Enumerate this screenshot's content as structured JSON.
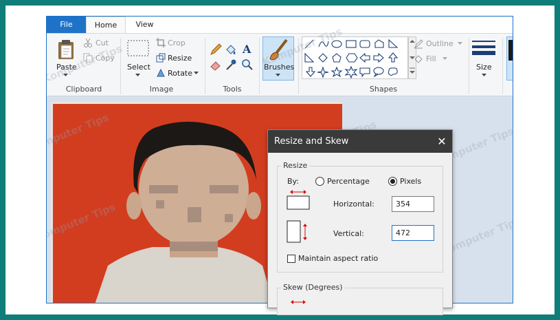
{
  "tabs": {
    "file": "File",
    "home": "Home",
    "view": "View"
  },
  "clipboard": {
    "paste": "Paste",
    "cut": "Cut",
    "copy": "Copy",
    "label": "Clipboard"
  },
  "image": {
    "select": "Select",
    "crop": "Crop",
    "resize": "Resize",
    "rotate": "Rotate",
    "label": "Image"
  },
  "tools": {
    "label": "Tools"
  },
  "brushes": {
    "label": "Brushes"
  },
  "shapes": {
    "outline": "Outline",
    "fill": "Fill",
    "label": "Shapes"
  },
  "size": {
    "label": "Size"
  },
  "dialog": {
    "title": "Resize and Skew",
    "close": "✕",
    "resize_legend": "Resize",
    "by_label": "By:",
    "percentage": "Percentage",
    "pixels": "Pixels",
    "horizontal_label": "Horizontal:",
    "horizontal_value": "354",
    "vertical_label": "Vertical:",
    "vertical_value": "472",
    "maintain_aspect": "Maintain aspect ratio",
    "skew_legend": "Skew (Degrees)"
  },
  "watermark": "Komputer Tips",
  "colors": {
    "accent": "#1e73c8",
    "frame": "#0f7d7a",
    "photo_bg": "#d23d20"
  }
}
